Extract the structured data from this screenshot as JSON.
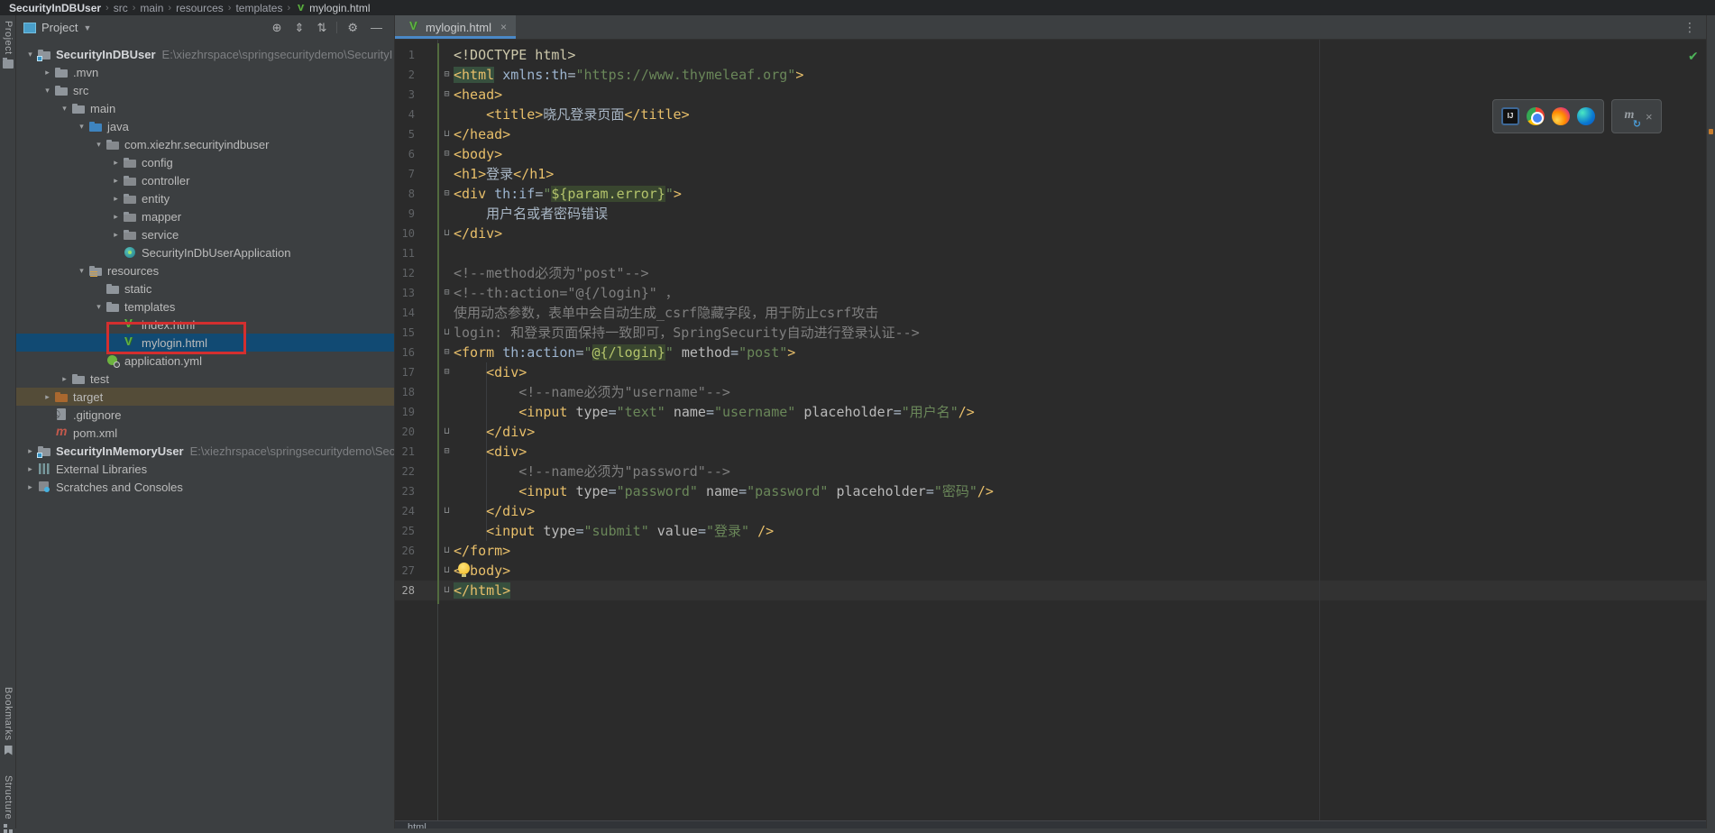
{
  "theme": {
    "panel_bg": "#3c3f41",
    "editor_bg": "#2b2b2b",
    "selection_blue": "#114a73",
    "excluded_row": "#544c38",
    "tab_underline": "#4a88c7",
    "tag_color": "#e8bf6a",
    "value_green": "#6a8759",
    "annotation_red": "#d32f2f",
    "vcs_added_green": "#526b3f"
  },
  "navbar": {
    "separator": "›",
    "items": [
      {
        "label": "SecurityInDBUser",
        "style": "root"
      },
      {
        "label": "src"
      },
      {
        "label": "main"
      },
      {
        "label": "resources"
      },
      {
        "label": "templates"
      },
      {
        "label": "mylogin.html",
        "style": "leaf",
        "icon": "thymeleaf-v-icon"
      }
    ]
  },
  "left_stripe": {
    "top": [
      {
        "label": "Project",
        "icon": "project-tool-icon"
      }
    ],
    "bottom": [
      {
        "label": "Bookmarks",
        "icon": "bookmark-icon"
      },
      {
        "label": "Structure",
        "icon": "structure-icon"
      }
    ]
  },
  "project_panel": {
    "title": "Project",
    "toolbar": [
      {
        "name": "locate-file-icon",
        "glyph": "⊕"
      },
      {
        "name": "expand-all-icon",
        "glyph": "⇕"
      },
      {
        "name": "collapse-all-icon",
        "glyph": "⇅"
      },
      {
        "name": "divider",
        "glyph": ""
      },
      {
        "name": "settings-gear-icon",
        "glyph": "⚙"
      },
      {
        "name": "hide-panel-icon",
        "glyph": "—"
      }
    ],
    "annotation": {
      "shape": "red-rectangle",
      "highlights": "mylogin.html"
    },
    "tree": [
      {
        "d": 0,
        "chev": "open",
        "icon": "folder-root",
        "label": "SecurityInDBUser",
        "bold": true,
        "path": "E:\\xiezhrspace\\springsecuritydemo\\SecurityI"
      },
      {
        "d": 1,
        "chev": "closed",
        "icon": "folder",
        "label": ".mvn"
      },
      {
        "d": 1,
        "chev": "open",
        "icon": "folder",
        "label": "src"
      },
      {
        "d": 2,
        "chev": "open",
        "icon": "folder",
        "label": "main"
      },
      {
        "d": 3,
        "chev": "open",
        "icon": "folder-java",
        "label": "java"
      },
      {
        "d": 4,
        "chev": "open",
        "icon": "package",
        "label": "com.xiezhr.securityindbuser"
      },
      {
        "d": 5,
        "chev": "closed",
        "icon": "package",
        "label": "config"
      },
      {
        "d": 5,
        "chev": "closed",
        "icon": "package",
        "label": "controller"
      },
      {
        "d": 5,
        "chev": "closed",
        "icon": "package",
        "label": "entity"
      },
      {
        "d": 5,
        "chev": "closed",
        "icon": "package",
        "label": "mapper"
      },
      {
        "d": 5,
        "chev": "closed",
        "icon": "package",
        "label": "service"
      },
      {
        "d": 5,
        "chev": "none",
        "icon": "app-class",
        "label": "SecurityInDbUserApplication"
      },
      {
        "d": 3,
        "chev": "open",
        "icon": "folder-res",
        "label": "resources"
      },
      {
        "d": 4,
        "chev": "none",
        "icon": "folder",
        "label": "static"
      },
      {
        "d": 4,
        "chev": "open",
        "icon": "folder",
        "label": "templates"
      },
      {
        "d": 5,
        "chev": "none",
        "icon": "vfile",
        "label": "index.html"
      },
      {
        "d": 5,
        "chev": "none",
        "icon": "vfile",
        "label": "mylogin.html",
        "sel": true
      },
      {
        "d": 4,
        "chev": "none",
        "icon": "yml",
        "label": "application.yml"
      },
      {
        "d": 2,
        "chev": "closed",
        "icon": "folder",
        "label": "test"
      },
      {
        "d": 1,
        "chev": "closed",
        "icon": "folder-target",
        "label": "target",
        "excl": true
      },
      {
        "d": 1,
        "chev": "none",
        "icon": "git",
        "label": ".gitignore"
      },
      {
        "d": 1,
        "chev": "none",
        "icon": "maven",
        "label": "pom.xml"
      },
      {
        "d": 0,
        "chev": "closed",
        "icon": "folder-root",
        "label": "SecurityInMemoryUser",
        "bold": true,
        "path": "E:\\xiezhrspace\\springsecuritydemo\\Sec"
      },
      {
        "d": 0,
        "chev": "closed",
        "icon": "lib",
        "label": "External Libraries"
      },
      {
        "d": 0,
        "chev": "closed",
        "icon": "scratch",
        "label": "Scratches and Consoles"
      }
    ]
  },
  "editor": {
    "tab": {
      "label": "mylogin.html",
      "icon": "thymeleaf-v-icon",
      "close_glyph": "×"
    },
    "tab_menu_glyph": "⋮",
    "inspection_status_glyph": "✔",
    "bottom_breadcrumb": "html",
    "widgets": {
      "browsers": [
        "intellij-idea-icon",
        "chrome-icon",
        "firefox-icon",
        "edge-icon"
      ],
      "maven_reload": {
        "icon": "maven-reload-icon",
        "close_glyph": "×"
      }
    },
    "lines": [
      {
        "n": 1,
        "fold": "",
        "tokens": [
          [
            "doc",
            "<!DOCTYPE html>"
          ]
        ]
      },
      {
        "n": 2,
        "fold": "start",
        "tokens": [
          [
            "taghl",
            "<html"
          ],
          [
            "plain",
            " "
          ],
          [
            "tha",
            "xmlns:th"
          ],
          [
            "eq",
            "="
          ],
          [
            "val",
            "\"https://www.thymeleaf.org\""
          ],
          [
            "tag",
            ">"
          ]
        ]
      },
      {
        "n": 3,
        "fold": "start",
        "tokens": [
          [
            "tag",
            "<head>"
          ]
        ]
      },
      {
        "n": 4,
        "fold": "",
        "tokens": [
          [
            "plain",
            "    "
          ],
          [
            "tag",
            "<title>"
          ],
          [
            "plain",
            "晓凡登录页面"
          ],
          [
            "tag",
            "</title>"
          ]
        ]
      },
      {
        "n": 5,
        "fold": "end",
        "tokens": [
          [
            "tag",
            "</head>"
          ]
        ]
      },
      {
        "n": 6,
        "fold": "start",
        "tokens": [
          [
            "tag",
            "<body>"
          ]
        ]
      },
      {
        "n": 7,
        "fold": "",
        "tokens": [
          [
            "tag",
            "<h1>"
          ],
          [
            "plain",
            "登录"
          ],
          [
            "tag",
            "</h1>"
          ]
        ]
      },
      {
        "n": 8,
        "fold": "start",
        "tokens": [
          [
            "tag",
            "<div"
          ],
          [
            "plain",
            " "
          ],
          [
            "tha",
            "th:if"
          ],
          [
            "eq",
            "="
          ],
          [
            "val",
            "\""
          ],
          [
            "inj",
            "${param.error}"
          ],
          [
            "val",
            "\""
          ],
          [
            "tag",
            ">"
          ]
        ]
      },
      {
        "n": 9,
        "fold": "",
        "tokens": [
          [
            "plain",
            "    用户名或者密码错误"
          ]
        ]
      },
      {
        "n": 10,
        "fold": "end",
        "tokens": [
          [
            "tag",
            "</div>"
          ]
        ]
      },
      {
        "n": 11,
        "fold": "",
        "tokens": []
      },
      {
        "n": 12,
        "fold": "",
        "tokens": [
          [
            "com",
            "<!--method必须为\"post\"-->"
          ]
        ]
      },
      {
        "n": 13,
        "fold": "start",
        "tokens": [
          [
            "com",
            "<!--th:action=\"@{/login}\" ，"
          ]
        ]
      },
      {
        "n": 14,
        "fold": "",
        "tokens": [
          [
            "com",
            "使用动态参数，表单中会自动生成_csrf隐藏字段，用于防止csrf攻击"
          ]
        ]
      },
      {
        "n": 15,
        "fold": "end",
        "tokens": [
          [
            "com",
            "login: 和登录页面保持一致即可，SpringSecurity自动进行登录认证-->"
          ]
        ]
      },
      {
        "n": 16,
        "fold": "start",
        "tokens": [
          [
            "tag",
            "<form"
          ],
          [
            "plain",
            " "
          ],
          [
            "tha",
            "th:action"
          ],
          [
            "eq",
            "="
          ],
          [
            "val",
            "\""
          ],
          [
            "inj",
            "@{/login}"
          ],
          [
            "val",
            "\""
          ],
          [
            "plain",
            " "
          ],
          [
            "attr",
            "method"
          ],
          [
            "eq",
            "="
          ],
          [
            "val",
            "\"post\""
          ],
          [
            "tag",
            ">"
          ]
        ]
      },
      {
        "n": 17,
        "fold": "start",
        "tokens": [
          [
            "plain",
            "    "
          ],
          [
            "tag",
            "<div>"
          ]
        ]
      },
      {
        "n": 18,
        "fold": "",
        "tokens": [
          [
            "plain",
            "        "
          ],
          [
            "com",
            "<!--name必须为\"username\"-->"
          ]
        ]
      },
      {
        "n": 19,
        "fold": "",
        "tokens": [
          [
            "plain",
            "        "
          ],
          [
            "tag",
            "<input"
          ],
          [
            "plain",
            " "
          ],
          [
            "attr",
            "type"
          ],
          [
            "eq",
            "="
          ],
          [
            "val",
            "\"text\""
          ],
          [
            "plain",
            " "
          ],
          [
            "attr",
            "name"
          ],
          [
            "eq",
            "="
          ],
          [
            "val",
            "\"username\""
          ],
          [
            "plain",
            " "
          ],
          [
            "attr",
            "placeholder"
          ],
          [
            "eq",
            "="
          ],
          [
            "val",
            "\"用户名\""
          ],
          [
            "tag",
            "/>"
          ]
        ]
      },
      {
        "n": 20,
        "fold": "end",
        "tokens": [
          [
            "plain",
            "    "
          ],
          [
            "tag",
            "</div>"
          ]
        ]
      },
      {
        "n": 21,
        "fold": "start",
        "tokens": [
          [
            "plain",
            "    "
          ],
          [
            "tag",
            "<div>"
          ]
        ]
      },
      {
        "n": 22,
        "fold": "",
        "tokens": [
          [
            "plain",
            "        "
          ],
          [
            "com",
            "<!--name必须为\"password\"-->"
          ]
        ]
      },
      {
        "n": 23,
        "fold": "",
        "tokens": [
          [
            "plain",
            "        "
          ],
          [
            "tag",
            "<input"
          ],
          [
            "plain",
            " "
          ],
          [
            "attr",
            "type"
          ],
          [
            "eq",
            "="
          ],
          [
            "val",
            "\"password\""
          ],
          [
            "plain",
            " "
          ],
          [
            "attr",
            "name"
          ],
          [
            "eq",
            "="
          ],
          [
            "val",
            "\"password\""
          ],
          [
            "plain",
            " "
          ],
          [
            "attr",
            "placeholder"
          ],
          [
            "eq",
            "="
          ],
          [
            "val",
            "\"密码\""
          ],
          [
            "tag",
            "/>"
          ]
        ]
      },
      {
        "n": 24,
        "fold": "end",
        "tokens": [
          [
            "plain",
            "    "
          ],
          [
            "tag",
            "</div>"
          ]
        ]
      },
      {
        "n": 25,
        "fold": "",
        "tokens": [
          [
            "plain",
            "    "
          ],
          [
            "tag",
            "<input"
          ],
          [
            "plain",
            " "
          ],
          [
            "attr",
            "type"
          ],
          [
            "eq",
            "="
          ],
          [
            "val",
            "\"submit\""
          ],
          [
            "plain",
            " "
          ],
          [
            "attr",
            "value"
          ],
          [
            "eq",
            "="
          ],
          [
            "val",
            "\"登录\""
          ],
          [
            "plain",
            " "
          ],
          [
            "tag",
            "/>"
          ]
        ]
      },
      {
        "n": 26,
        "fold": "end",
        "tokens": [
          [
            "tag",
            "</form>"
          ]
        ]
      },
      {
        "n": 27,
        "fold": "end",
        "tokens": [
          [
            "tag",
            "</body>"
          ]
        ],
        "bulb": true
      },
      {
        "n": 28,
        "fold": "end",
        "tokens": [
          [
            "taghl",
            "</html>"
          ]
        ],
        "caret": true
      }
    ]
  }
}
